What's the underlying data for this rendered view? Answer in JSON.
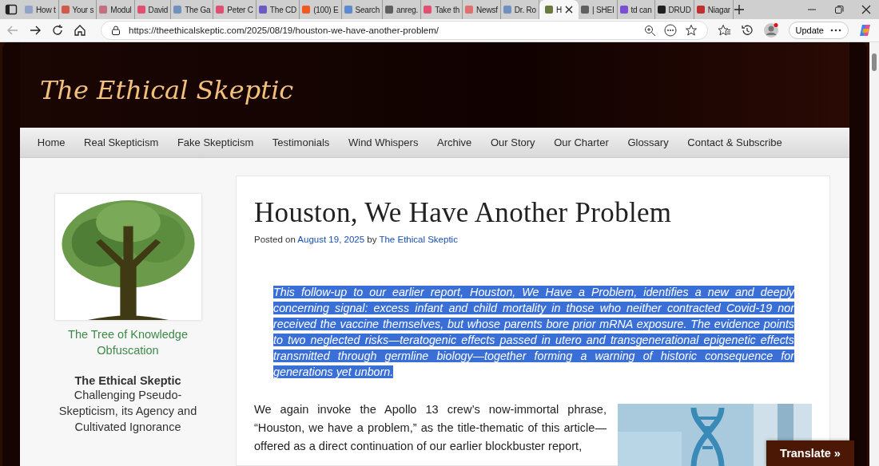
{
  "browser": {
    "tabs": [
      {
        "label": "How t",
        "color": "#8fa4c8",
        "selected": false
      },
      {
        "label": "Your s",
        "color": "#d05a4a",
        "selected": false
      },
      {
        "label": "Modul",
        "color": "#c07080",
        "selected": false
      },
      {
        "label": "David",
        "color": "#e05070",
        "selected": false
      },
      {
        "label": "The Ga",
        "color": "#7090c0",
        "selected": false
      },
      {
        "label": "Peter C",
        "color": "#e05070",
        "selected": false
      },
      {
        "label": "The CD",
        "color": "#6a5cc0",
        "selected": false
      },
      {
        "label": "(100) E",
        "color": "#f05a22",
        "selected": false
      },
      {
        "label": "Search",
        "color": "#5a8ad0",
        "selected": false
      },
      {
        "label": "anreg.",
        "color": "#606060",
        "selected": false
      },
      {
        "label": "Take th",
        "color": "#e05070",
        "selected": false
      },
      {
        "label": "Newsf",
        "color": "#e07070",
        "selected": false
      },
      {
        "label": "Dr. Ro",
        "color": "#7090c0",
        "selected": false
      },
      {
        "label": "H",
        "color": "#6a7a40",
        "selected": true
      },
      {
        "label": "| SHEI",
        "color": "#606060",
        "selected": false
      },
      {
        "label": "td can",
        "color": "#7b4fd0",
        "selected": false
      },
      {
        "label": "DRUD",
        "color": "#202020",
        "selected": false
      },
      {
        "label": "Niagar",
        "color": "#c03030",
        "selected": false
      }
    ],
    "url": "https://theethicalskeptic.com/2025/08/19/houston-we-have-another-problem/",
    "update_button": "Update"
  },
  "site": {
    "title": "The Ethical Skeptic",
    "nav": [
      "Home",
      "Real Skepticism",
      "Fake Skepticism",
      "Testimonials",
      "Wind Whispers",
      "Archive",
      "Our Story",
      "Our Charter",
      "Glossary",
      "Contact & Subscribe"
    ]
  },
  "sidebar": {
    "caption": [
      "The Tree of Knowledge",
      "Obfuscation"
    ],
    "name": "The Ethical Skeptic",
    "tagline": [
      "Challenging Pseudo-",
      "Skepticism, its Agency and",
      "Cultivated Ignorance"
    ]
  },
  "article": {
    "title": "Houston, We Have Another Problem",
    "posted_prefix": "Posted on",
    "date": "August 19, 2025",
    "by": "by",
    "author": "The Ethical Skeptic",
    "excerpt": {
      "text": "This follow-up to our earlier report, Houston, We Have a Problem, identifies a new and deeply concerning signal: excess infant and child mortality in those who neither contracted Covid-19 nor received the vaccine themselves, but whose parents bore prior mRNA exposure. The evidence points to two neglected risks—teratogenic effects passed in utero and transgenerational epigenetic effects transmitted through germline biology—together forming a warning of historic consequence for generations yet unborn.",
      "highlighted": true
    },
    "body": "We again invoke the Apollo 13 crew’s now-immortal phrase, “Houston, we have a problem,” as the title-thematic of this article—offered as a direct continuation of our earlier blockbuster report,"
  },
  "translate_button": "Translate »"
}
